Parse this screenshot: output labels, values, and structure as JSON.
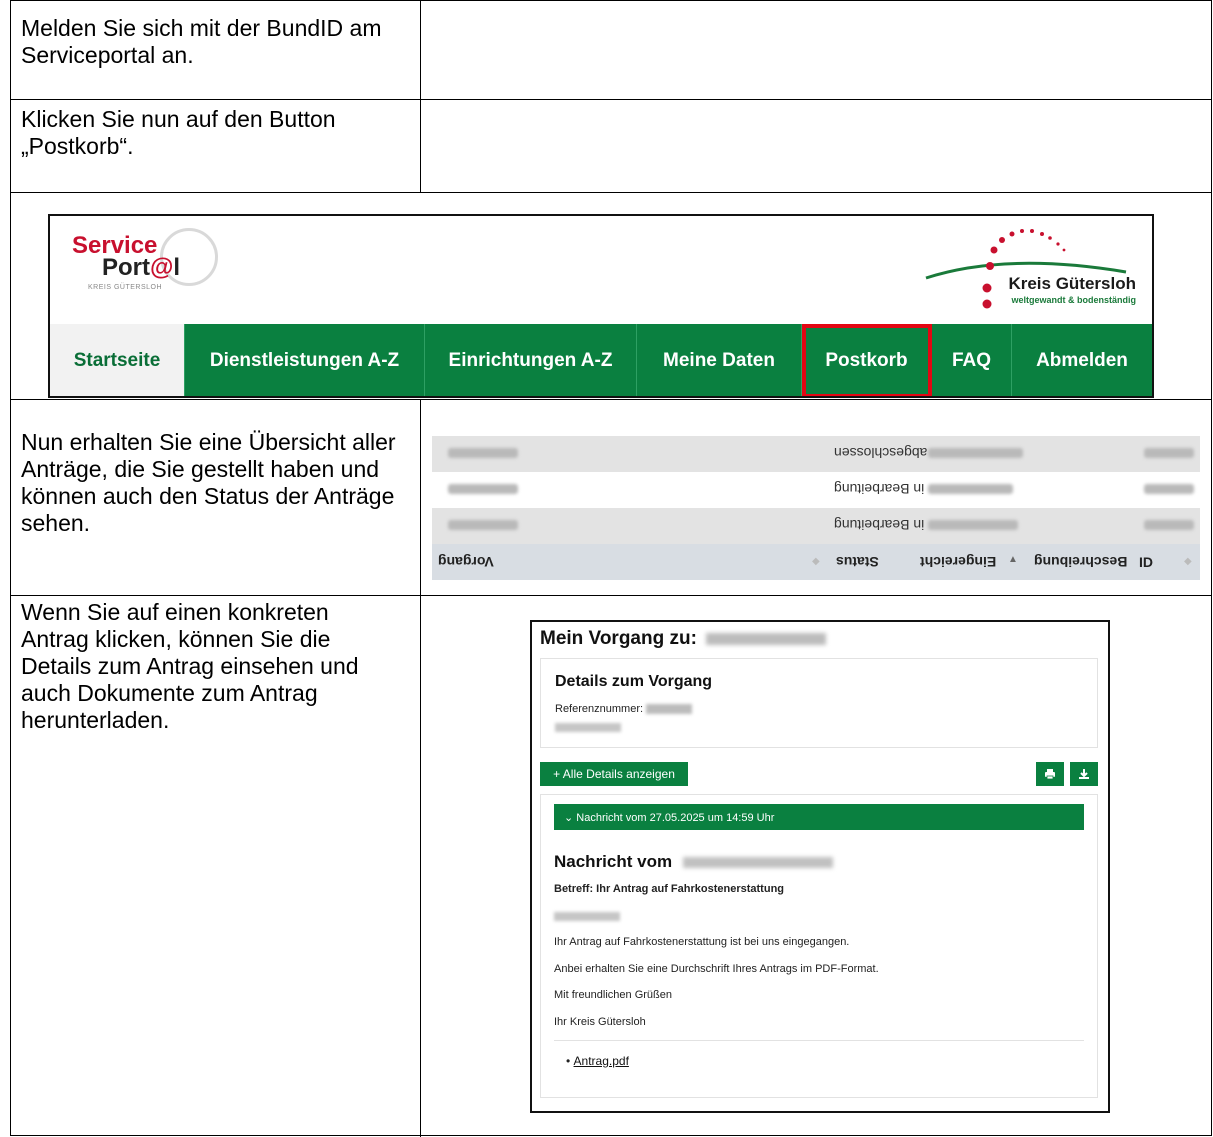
{
  "steps": [
    {
      "text": "Melden Sie sich mit der BundID am Serviceportal an."
    },
    {
      "text": "Klicken Sie nun auf den Button „Postkorb“."
    },
    {
      "text": "Nun erhalten Sie eine Übersicht aller Anträge, die Sie gestellt haben und können auch den Status der Anträge sehen."
    },
    {
      "text": "Wenn Sie auf einen konkreten Antrag klicken, können Sie die Details zum Antrag einsehen und auch Dokumente zum Antrag herunterladen."
    }
  ],
  "portal": {
    "logo_line1": "Service",
    "logo_line2_prefix": "Port",
    "logo_line2_at": "@",
    "logo_line2_suffix": "l",
    "logo_sub": "KREIS GÜTERSLOH",
    "kreis_name": "Kreis Gütersloh",
    "kreis_sub": "weltgewandt & bodenständig",
    "nav": [
      "Startseite",
      "Dienstleistungen A-Z",
      "Einrichtungen A-Z",
      "Meine Daten",
      "Postkorb",
      "FAQ",
      "Abmelden"
    ],
    "highlighted_nav": "Postkorb",
    "colors": {
      "green": "#0a8040",
      "highlight": "#e30613"
    }
  },
  "overview": {
    "rows": [
      {
        "status": "abgeschlossen"
      },
      {
        "status": "in Bearbeitung"
      },
      {
        "status": "in Bearbeitung"
      }
    ],
    "headers": [
      "Vorgang",
      "Status",
      "Eingereicht",
      "Beschreibung",
      "ID"
    ],
    "orientation": "upside-down"
  },
  "detail": {
    "title": "Mein Vorgang zu:",
    "panel_title": "Details zum Vorgang",
    "ref_label": "Referenznummer:",
    "all_details_button": "+ Alle Details anzeigen",
    "print_icon": "print-icon",
    "download_icon": "download-icon",
    "message_header": "⌄ Nachricht vom 27.05.2025 um 14:59 Uhr",
    "message_title": "Nachricht vom",
    "subject": "Betreff: Ihr Antrag auf Fahrkostenerstattung",
    "body_lines": [
      "Ihr Antrag auf Fahrkostenerstattung ist bei uns eingegangen.",
      "Anbei erhalten Sie eine Durchschrift Ihres Antrags im PDF-Format.",
      "Mit freundlichen Grüßen",
      "Ihr Kreis Gütersloh"
    ],
    "attachment": "Antrag.pdf"
  }
}
